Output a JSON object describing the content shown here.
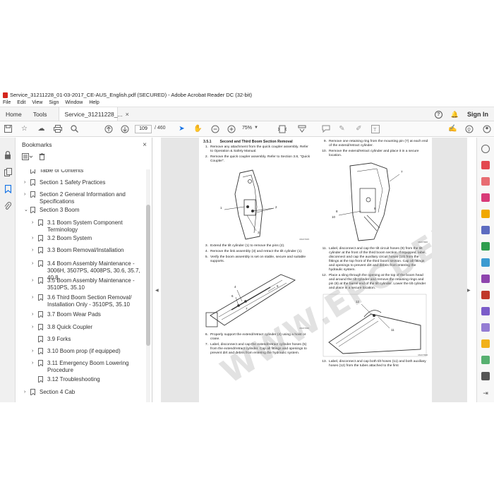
{
  "window": {
    "title": "Service_31211228_01-03-2017_CE-AUS_English.pdf (SECURED) - Adobe Acrobat Reader DC (32-bit)"
  },
  "menu": [
    "File",
    "Edit",
    "View",
    "Sign",
    "Window",
    "Help"
  ],
  "tabs": {
    "home": "Home",
    "tools": "Tools",
    "doc": "Service_31211228_...",
    "doc_close": "×"
  },
  "tabbar_right": {
    "help": "?",
    "bell": "🔔",
    "signin": "Sign In"
  },
  "toolbar": {
    "page_current": "109",
    "page_total": "/ 460",
    "zoom": "75%",
    "zoom_caret": "▼"
  },
  "bookmarks": {
    "title": "Bookmarks",
    "close": "×",
    "items": [
      {
        "label": "Table of Contents",
        "chev": "",
        "indent": 0
      },
      {
        "label": "Section 1 Safety Practices",
        "chev": "›",
        "indent": 0
      },
      {
        "label": "Section 2 General Information and Specifications",
        "chev": "›",
        "indent": 0
      },
      {
        "label": "Section 3 Boom",
        "chev": "⌄",
        "indent": 0
      },
      {
        "label": "3.1 Boom System Component Terminology",
        "chev": "›",
        "indent": 1
      },
      {
        "label": "3.2 Boom System",
        "chev": "›",
        "indent": 1
      },
      {
        "label": "3.3 Boom Removal/Installation",
        "chev": "›",
        "indent": 1
      },
      {
        "label": "3.4 Boom Assembly Maintenance - 3006H, 3507PS, 4008PS, 30.6, 35.7, 40.8",
        "chev": "›",
        "indent": 1
      },
      {
        "label": "3.5 Boom Assembly Maintenance - 3510PS, 35.10",
        "chev": "›",
        "indent": 1
      },
      {
        "label": "3.6 Third Boom Section Removal/ Installation Only - 3510PS, 35.10",
        "chev": "›",
        "indent": 1
      },
      {
        "label": "3.7 Boom Wear Pads",
        "chev": "›",
        "indent": 1
      },
      {
        "label": "3.8 Quick Coupler",
        "chev": "›",
        "indent": 1
      },
      {
        "label": "3.9 Forks",
        "chev": "",
        "indent": 1
      },
      {
        "label": "3.10 Boom prop (if equipped)",
        "chev": "›",
        "indent": 1
      },
      {
        "label": "3.11 Emergency Boom Lowering Procedure",
        "chev": "›",
        "indent": 1
      },
      {
        "label": "3.12 Troubleshooting",
        "chev": "",
        "indent": 1
      },
      {
        "label": "Section 4 Cab",
        "chev": "›",
        "indent": 0
      }
    ]
  },
  "document": {
    "section_num": "3.5.1",
    "section_title": "Second and Third Boom Section Removal",
    "watermark": "WWW.EPCDEPOT.COM",
    "left_steps": [
      {
        "n": "1.",
        "t": "Remove any attachment from the quick coupler assembly. Refer to Operation & Safety Manual."
      },
      {
        "n": "2.",
        "t": "Remove the quick coupler assembly. Refer to Section 3.8, \"Quick Coupler\"."
      },
      {
        "n": "3.",
        "t": "Extend the tilt cylinder (1) to remove the pins (2)."
      },
      {
        "n": "4.",
        "t": "Remove the link assembly (3) and retract the tilt cylinder (1)."
      },
      {
        "n": "5.",
        "t": "Verify the boom assembly is set on stable, secure and suitable supports."
      },
      {
        "n": "6.",
        "t": "Properly support the extend/retract cylinder (4) using a hoist or crane."
      },
      {
        "n": "7.",
        "t": "Label, disconnect and cap the extend/retract cylinder hoses (5) from the extend/retract cylinder. Cap all fittings and openings to prevent dirt and debris from entering the hydraulic system."
      }
    ],
    "right_steps": [
      {
        "n": "9.",
        "t": "Remove one retaining ring from the mounting pin (7) at each end of the extend/retract cylinder."
      },
      {
        "n": "10.",
        "t": "Remove the extend/retract cylinder and place it in a secure location."
      },
      {
        "n": "11.",
        "t": "Label, disconnect and cap the tilt circuit hoses (9) from the tilt cylinder at the front of the third boom section. If equipped, label, disconnect and cap the auxiliary circuit hoses (10) from the fittings at the top front of the third boom section. Cap all fittings and openings to prevent dirt and debris from entering the hydraulic system."
      },
      {
        "n": "12.",
        "t": "Place a sling through the opening at the top of the boom head and around the tilt cylinder and remove the retaining rings and pin (8) at the barrel end of the tilt cylinder. Lower the tilt cylinder and place in a secure location."
      },
      {
        "n": "13.",
        "t": "Label, disconnect and cap both tilt hoses (11) and both auxiliary hoses (12) from the tubes attached to the first"
      }
    ],
    "fig_labels": {
      "f1_a": "1",
      "f1_b": "2",
      "f1_c": "3",
      "f1_code": "MAO7015",
      "f2_a": "4",
      "f2_b": "5",
      "f2_c": "6",
      "f2_d": "7",
      "f2_code": "MAO7016",
      "f3_a": "7",
      "f3_b": "8",
      "f3_c": "9",
      "f3_d": "10",
      "f3_code": "MAO7900",
      "f4_a": "12",
      "f4_b": "11",
      "f4_code": "MAO7900"
    }
  }
}
